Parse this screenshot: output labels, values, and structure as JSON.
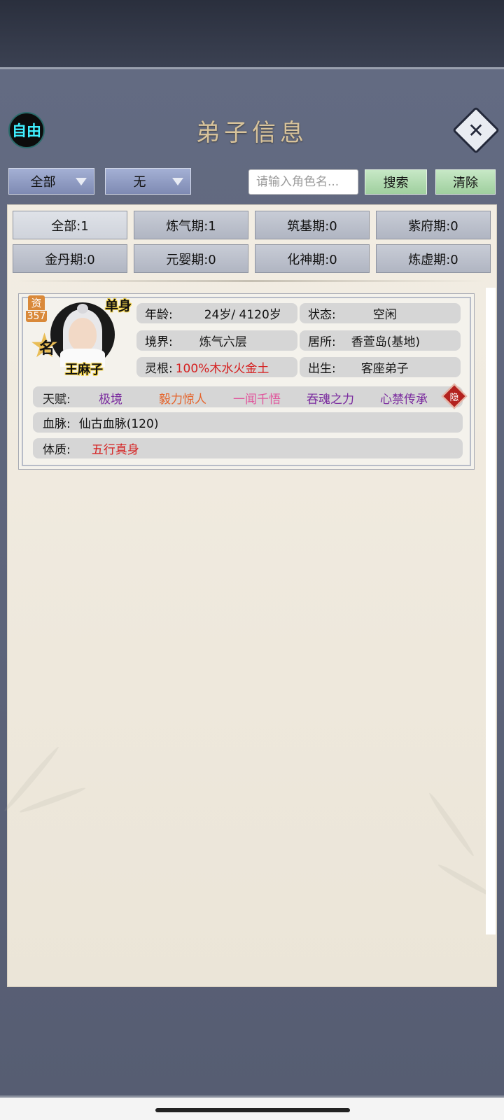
{
  "header": {
    "mode_badge": "自由",
    "title": "弟子信息",
    "close_icon": "close-x-icon"
  },
  "filters": {
    "dropdown_1": "全部",
    "dropdown_2": "无",
    "search_placeholder": "请输入角色名...",
    "search_button": "搜索",
    "clear_button": "清除"
  },
  "realm_tabs": [
    {
      "label": "全部:1"
    },
    {
      "label": "炼气期:1"
    },
    {
      "label": "筑基期:0"
    },
    {
      "label": "紫府期:0"
    },
    {
      "label": "金丹期:0"
    },
    {
      "label": "元婴期:0"
    },
    {
      "label": "化神期:0"
    },
    {
      "label": "炼虚期:0"
    }
  ],
  "disciple": {
    "aptitude_label": "资",
    "aptitude_value": "357",
    "rank_badge": "名",
    "marital_status": "单身",
    "name": "王麻子",
    "age_label": "年龄:",
    "age_value": "24岁/ 4120岁",
    "status_label": "状态:",
    "status_value": "空闲",
    "realm_label": "境界:",
    "realm_value": "炼气六层",
    "residence_label": "居所:",
    "residence_value": "香萱岛(基地)",
    "root_label": "灵根:",
    "root_value": "100%木水火金土",
    "origin_label": "出生:",
    "origin_value": "客座弟子",
    "talent_label": "天赋:",
    "talents": [
      {
        "name": "极境",
        "color": "#7a2a9e"
      },
      {
        "name": "毅力惊人",
        "color": "#e5632a"
      },
      {
        "name": "一闻千悟",
        "color": "#e0569c"
      },
      {
        "name": "吞魂之力",
        "color": "#7a2a9e"
      },
      {
        "name": "心禁传承",
        "color": "#7a2a9e"
      }
    ],
    "hide_badge": "隐",
    "bloodline_label": "血脉:",
    "bloodline_value": "仙古血脉(120)",
    "physique_label": "体质:",
    "physique_value": "五行真身"
  },
  "colors": {
    "panel": "#5f667c",
    "content_bg": "#f0ebe0",
    "accent_red": "#d51f1f",
    "badge_cyan": "#3ff0ff"
  }
}
